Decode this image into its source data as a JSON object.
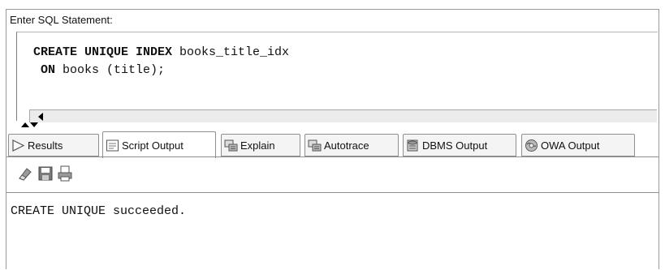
{
  "worksheet": {
    "label": "Enter SQL Statement:",
    "code": {
      "line1_kw": "CREATE UNIQUE INDEX",
      "line1_rest": " books_title_idx",
      "line2_kw": "ON",
      "line2_rest": " books (title);"
    }
  },
  "tabs": [
    {
      "label": "Results",
      "icon": "results-play-icon"
    },
    {
      "label": "Script Output",
      "icon": "script-output-icon",
      "active": true
    },
    {
      "label": "Explain",
      "icon": "explain-icon"
    },
    {
      "label": "Autotrace",
      "icon": "autotrace-icon"
    },
    {
      "label": "DBMS Output",
      "icon": "dbms-output-icon"
    },
    {
      "label": "OWA Output",
      "icon": "owa-output-icon"
    }
  ],
  "toolbar": {
    "icons": [
      "eraser-icon",
      "save-icon",
      "print-icon"
    ]
  },
  "output": {
    "text": "CREATE UNIQUE succeeded."
  }
}
